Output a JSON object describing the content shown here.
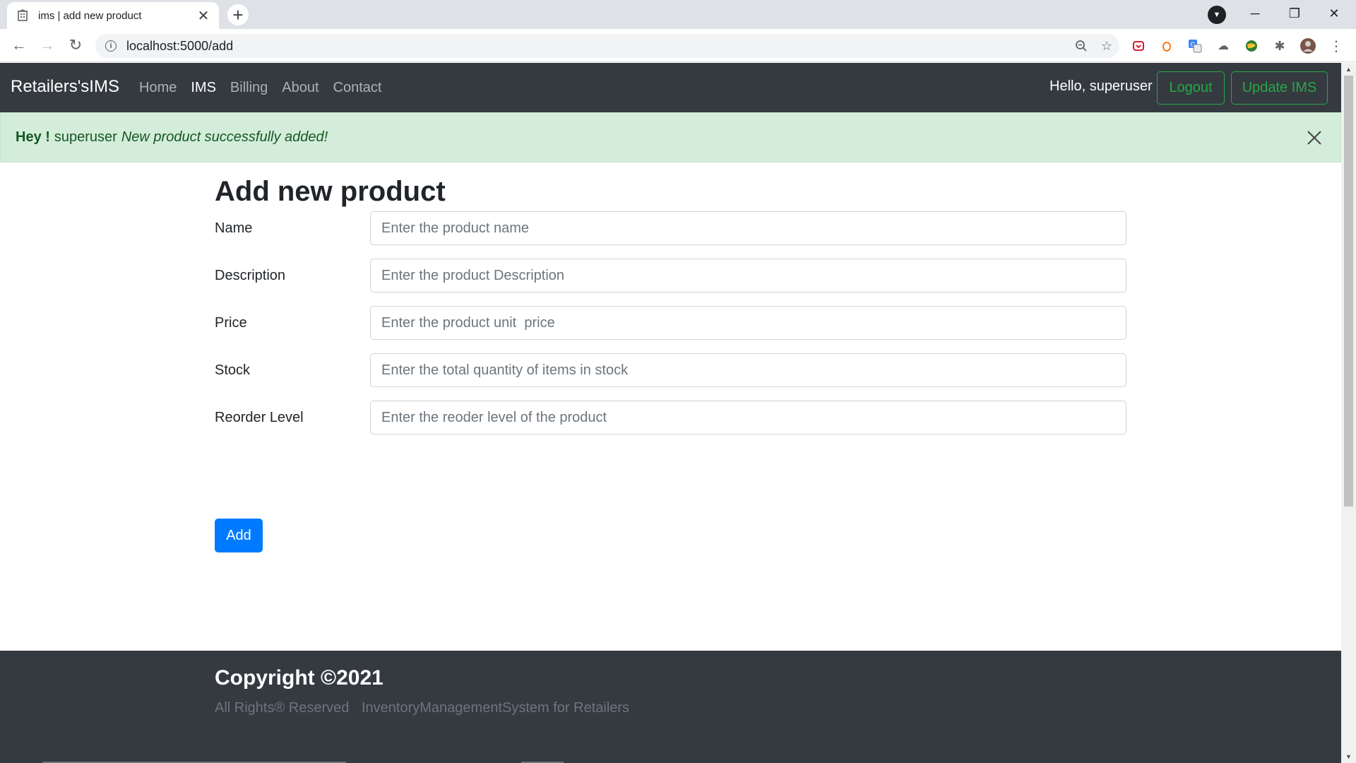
{
  "browser": {
    "tab_title": "ims | add new product",
    "tab_close": "✕",
    "new_tab": "+",
    "url": "localhost:5000/add",
    "window_controls": {
      "minimize": "─",
      "restore": "❐",
      "close": "✕"
    }
  },
  "navbar": {
    "brand": "Retailers'sIMS",
    "links": [
      {
        "label": "Home",
        "active": false
      },
      {
        "label": "IMS",
        "active": true
      },
      {
        "label": "Billing",
        "active": false
      },
      {
        "label": "About",
        "active": false
      },
      {
        "label": "Contact",
        "active": false
      }
    ],
    "greeting": "Hello, superuser",
    "logout_label": "Logout",
    "update_label": "Update IMS"
  },
  "alert": {
    "hey": "Hey !",
    "user": "superuser",
    "message": "New product successfully added!"
  },
  "form": {
    "title": "Add new product",
    "fields": [
      {
        "label": "Name",
        "placeholder": "Enter the product name",
        "value": ""
      },
      {
        "label": "Description",
        "placeholder": "Enter the product Description",
        "value": ""
      },
      {
        "label": "Price",
        "placeholder": "Enter the product unit  price",
        "value": ""
      },
      {
        "label": "Stock",
        "placeholder": "Enter the total quantity of items in stock",
        "value": ""
      },
      {
        "label": "Reorder Level",
        "placeholder": "Enter the reoder level of the product",
        "value": ""
      }
    ],
    "submit_label": "Add"
  },
  "footer": {
    "title": "Copyright ©2021",
    "rights": "All Rights® Reserved",
    "tagline": "InventoryManagementSystem for Retailers"
  },
  "colors": {
    "navbar_bg": "#343a40",
    "success_green": "#28a745",
    "alert_bg": "#d4edda",
    "primary_blue": "#007bff"
  },
  "icons": {
    "favicon": "building-icon",
    "back": "arrow-left-icon",
    "forward": "arrow-right-icon",
    "reload": "reload-icon",
    "site_info": "info-icon",
    "zoom": "zoom-icon",
    "bookmark": "star-icon",
    "alert_close": "close-icon"
  }
}
